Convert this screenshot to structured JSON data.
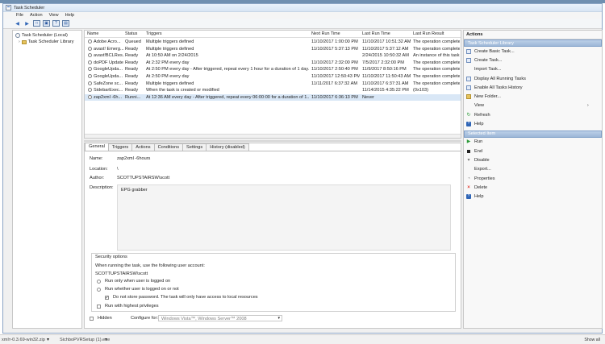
{
  "window": {
    "title": "Task Scheduler",
    "menu": [
      "File",
      "Action",
      "View",
      "Help"
    ]
  },
  "tree": [
    {
      "label": "Task Scheduler (Local)"
    },
    {
      "label": "Task Scheduler Library"
    }
  ],
  "task_table": {
    "headers": [
      "Name",
      "Status",
      "Triggers",
      "Next Run Time",
      "Last Run Time",
      "Last Run Result"
    ],
    "rows": [
      [
        "Adobe Acro...",
        "Queued",
        "Multiple triggers defined",
        "11/10/2017 1:00:00 PM",
        "11/10/2017 10:51:32 AM",
        "The operation complete"
      ],
      [
        "avast! Emerg...",
        "Ready",
        "Multiple triggers defined",
        "11/10/2017 5:37:13 PM",
        "11/10/2017 5:37:12 AM",
        "The operation complete"
      ],
      [
        "avast!BCLRes...",
        "Ready",
        "At 10:50 AM on 2/24/2015",
        "",
        "2/24/2015 10:50:32 AM",
        "An instance of this task"
      ],
      [
        "doPDF Update",
        "Ready",
        "At 2:32 PM every day",
        "11/10/2017 2:32:00 PM",
        "7/5/2017 2:32:00 PM",
        "The operation complete"
      ],
      [
        "GoogleUpda...",
        "Ready",
        "At 2:50 PM every day - After triggered, repeat every 1 hour for a duration of 1 day.",
        "11/10/2017 2:50:40 PM",
        "11/9/2017 8:50:16 PM",
        "The operation complete"
      ],
      [
        "GoogleUpda...",
        "Ready",
        "At 2:50 PM every day",
        "11/10/2017 12:50:43 PM",
        "11/10/2017 11:50:43 AM",
        "The operation complete"
      ],
      [
        "SafeZone sc...",
        "Ready",
        "Multiple triggers defined",
        "11/11/2017 6:37:32 AM",
        "11/10/2017 6:37:31 AM",
        "The operation complete"
      ],
      [
        "SidebarExec...",
        "Ready",
        "When the task is created or modified",
        "",
        "11/14/2015 4:35:22 PM",
        "(0x103)"
      ],
      [
        "zap2xml -6h...",
        "Runni...",
        "At 12:36 AM every day - After triggered, repeat every 06:00:00 for a duration of 1...",
        "11/10/2017 6:36:13 PM",
        "Never",
        ""
      ]
    ]
  },
  "detail_tabs": [
    "General",
    "Triggers",
    "Actions",
    "Conditions",
    "Settings",
    "History (disabled)"
  ],
  "general": {
    "name_label": "Name:",
    "name_value": "zap2xml -6hours",
    "location_label": "Location:",
    "location_value": "\\",
    "author_label": "Author:",
    "author_value": "SCOTTUPSTAIRSW\\scott",
    "description_label": "Description:",
    "description_value": "EPG grabber"
  },
  "security": {
    "title": "Security options",
    "account_prompt": "When running the task, use the following user account:",
    "account_value": "SCOTTUPSTAIRSW\\scott",
    "options": [
      "Run only when user is logged on",
      "Run whether user is logged on or not",
      "Do not store password.  The task will only have access to local resources",
      "Run with highest privileges"
    ]
  },
  "bottom_options": {
    "hidden_label": "Hidden",
    "configure_label": "Configure for:",
    "configure_value": "Windows Vista™, Windows Server™ 2008"
  },
  "actions": {
    "title": "Actions",
    "library_section": "Task Scheduler Library",
    "library_items": [
      "Create Basic Task...",
      "Create Task...",
      "Import Task...",
      "Display All Running Tasks",
      "Enable All Tasks History",
      "New Folder...",
      "View",
      "Refresh",
      "Help"
    ],
    "selected_section": "Selected Item",
    "selected_items": [
      "Run",
      "End",
      "Disable",
      "Export...",
      "Properties",
      "Delete",
      "Help"
    ]
  },
  "taskbar": {
    "items": [
      "xmlт-0.3.69-win32.zip",
      "SichboPVRSetup (1).exe"
    ],
    "show_all": "Show all"
  }
}
